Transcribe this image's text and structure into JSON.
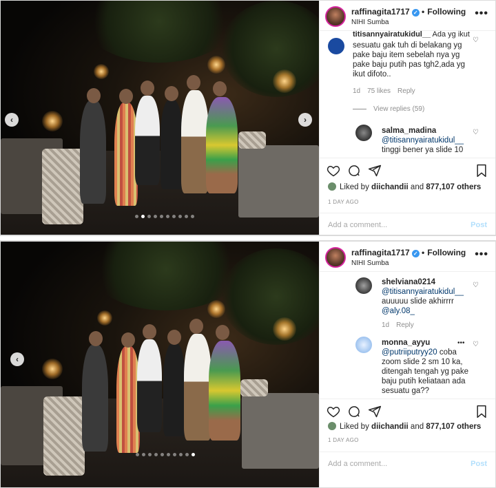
{
  "post1": {
    "username": "raffinagita1717",
    "follow_label": "Following",
    "location": "NIHI Sumba",
    "more_label": "•••",
    "comments": {
      "c1_partial_user": "titisannyairatukidul__",
      "c1_partial_rest": "Ada yg ikut",
      "c1_text": "sesuatu gak tuh di belakang yg pake baju item sebelah nya yg pake baju putih pas tgh2,ada yg ikut difoto..",
      "c1_time": "1d",
      "c1_likes": "75 likes",
      "c1_reply": "Reply",
      "view_replies": "View replies (59)",
      "c2_user": "salma_madina",
      "c2_mention": "@titisannyairatukidul__",
      "c2_text": "tinggi bener ya slide 10"
    },
    "liked_by_prefix": "Liked by",
    "liked_by_user": "diichandii",
    "liked_by_and": "and",
    "liked_by_count": "877,107 others",
    "time_ago": "1 DAY AGO",
    "add_comment_placeholder": "Add a comment...",
    "post_label": "Post"
  },
  "post2": {
    "username": "raffinagita1717",
    "follow_label": "Following",
    "location": "NIHI Sumba",
    "more_label": "•••",
    "comments": {
      "c1_user": "shelviana0214",
      "c1_mention": "@titisannyairatukidul__",
      "c1_text": "auuuuu slide akhirrrr",
      "c1_mention2": "@aly.08_",
      "c1_time": "1d",
      "c1_reply": "Reply",
      "c2_user": "monna_ayyu",
      "c2_mention": "@putriiputryy20",
      "c2_text_a": "coba",
      "c2_text": "zoom slide 2 sm 10 ka, ditengah tengah yg pake baju putih keliataan ada sesuatu ga??"
    },
    "liked_by_prefix": "Liked by",
    "liked_by_user": "diichandii",
    "liked_by_and": "and",
    "liked_by_count": "877,107 others",
    "time_ago": "1 DAY AGO",
    "add_comment_placeholder": "Add a comment...",
    "post_label": "Post"
  },
  "icons": {
    "verified": "✓",
    "prev": "‹",
    "next": "›",
    "heart_small": "♡"
  },
  "colors": {
    "accent_blue": "#3897f0",
    "mention": "#00376b",
    "muted": "#8e8e8e",
    "post_disabled": "#b2dffc"
  }
}
